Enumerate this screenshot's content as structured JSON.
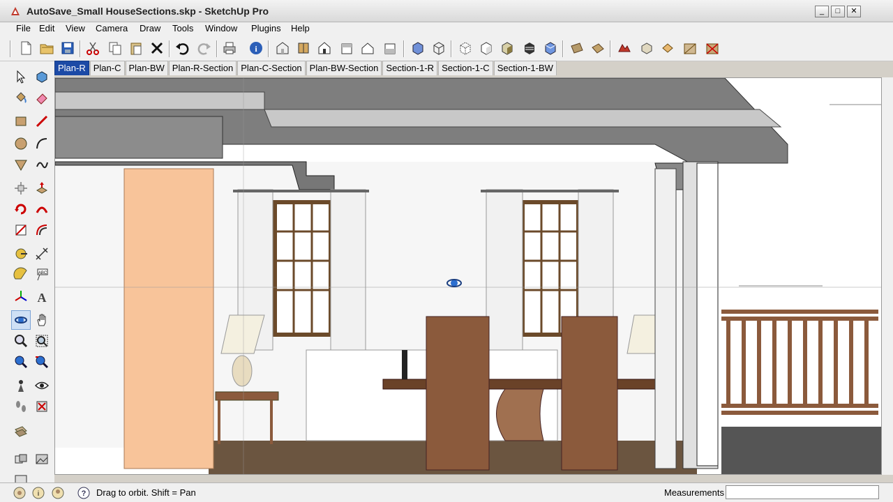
{
  "window": {
    "title": "AutoSave_Small HouseSections.skp - SketchUp Pro",
    "min_glyph": "_",
    "max_glyph": "□",
    "close_glyph": "✕"
  },
  "menubar": {
    "items": [
      "File",
      "Edit",
      "View",
      "Camera",
      "Draw",
      "Tools",
      "Window",
      "Plugins",
      "Help"
    ]
  },
  "toolbar": {
    "icons": [
      "new-icon",
      "open-icon",
      "save-icon",
      "cut-icon",
      "copy-icon",
      "paste-icon",
      "erase-icon",
      "undo-icon",
      "redo-icon",
      "print-icon",
      "model-info-icon",
      "iso-view-icon",
      "top-view-icon",
      "front-view-icon",
      "right-view-icon",
      "back-view-icon",
      "left-view-icon",
      "xray-icon",
      "wireframe-icon",
      "hidden-line-icon",
      "shaded-icon",
      "shaded-textures-icon",
      "monochrome-icon",
      "section-display-icon",
      "section-plane-icon",
      "section-cuts-icon",
      "terrain-icon",
      "sandbox-icon",
      "shadows-icon",
      "fog-icon",
      "match-photo-icon"
    ]
  },
  "scenes": {
    "tabs": [
      "Plan-R",
      "Plan-C",
      "Plan-BW",
      "Plan-R-Section",
      "Plan-C-Section",
      "Plan-BW-Section",
      "Section-1-R",
      "Section-1-C",
      "Section-1-BW"
    ],
    "active": "Plan-R"
  },
  "tools": {
    "items": [
      "select-icon",
      "component-icon",
      "paint-bucket-icon",
      "eraser-icon",
      "rectangle-icon",
      "line-icon",
      "circle-icon",
      "arc-icon",
      "polygon-icon",
      "freehand-icon",
      "move-icon",
      "push-pull-icon",
      "rotate-icon",
      "follow-me-icon",
      "scale-icon",
      "offset-icon",
      "tape-measure-icon",
      "dimension-icon",
      "protractor-icon",
      "text-icon",
      "axes-icon",
      "3d-text-icon",
      "orbit-icon",
      "pan-icon",
      "zoom-icon",
      "zoom-window-icon",
      "zoom-extents-icon",
      "previous-view-icon",
      "position-camera-icon",
      "look-around-icon",
      "walk-icon",
      "section-plane-tool-icon",
      "layer-icon",
      "outliner-icon",
      "scene-icon",
      "materials-icon"
    ],
    "selected": "orbit-icon"
  },
  "status": {
    "hint": "Drag to orbit.  Shift = Pan",
    "measurements_label": "Measurements",
    "measurements_value": ""
  },
  "colors": {
    "accent": "#1c4aa6",
    "wood": "#8b5a3c",
    "orange_panel": "#f8c49a",
    "ceiling": "#6a6a6a"
  }
}
